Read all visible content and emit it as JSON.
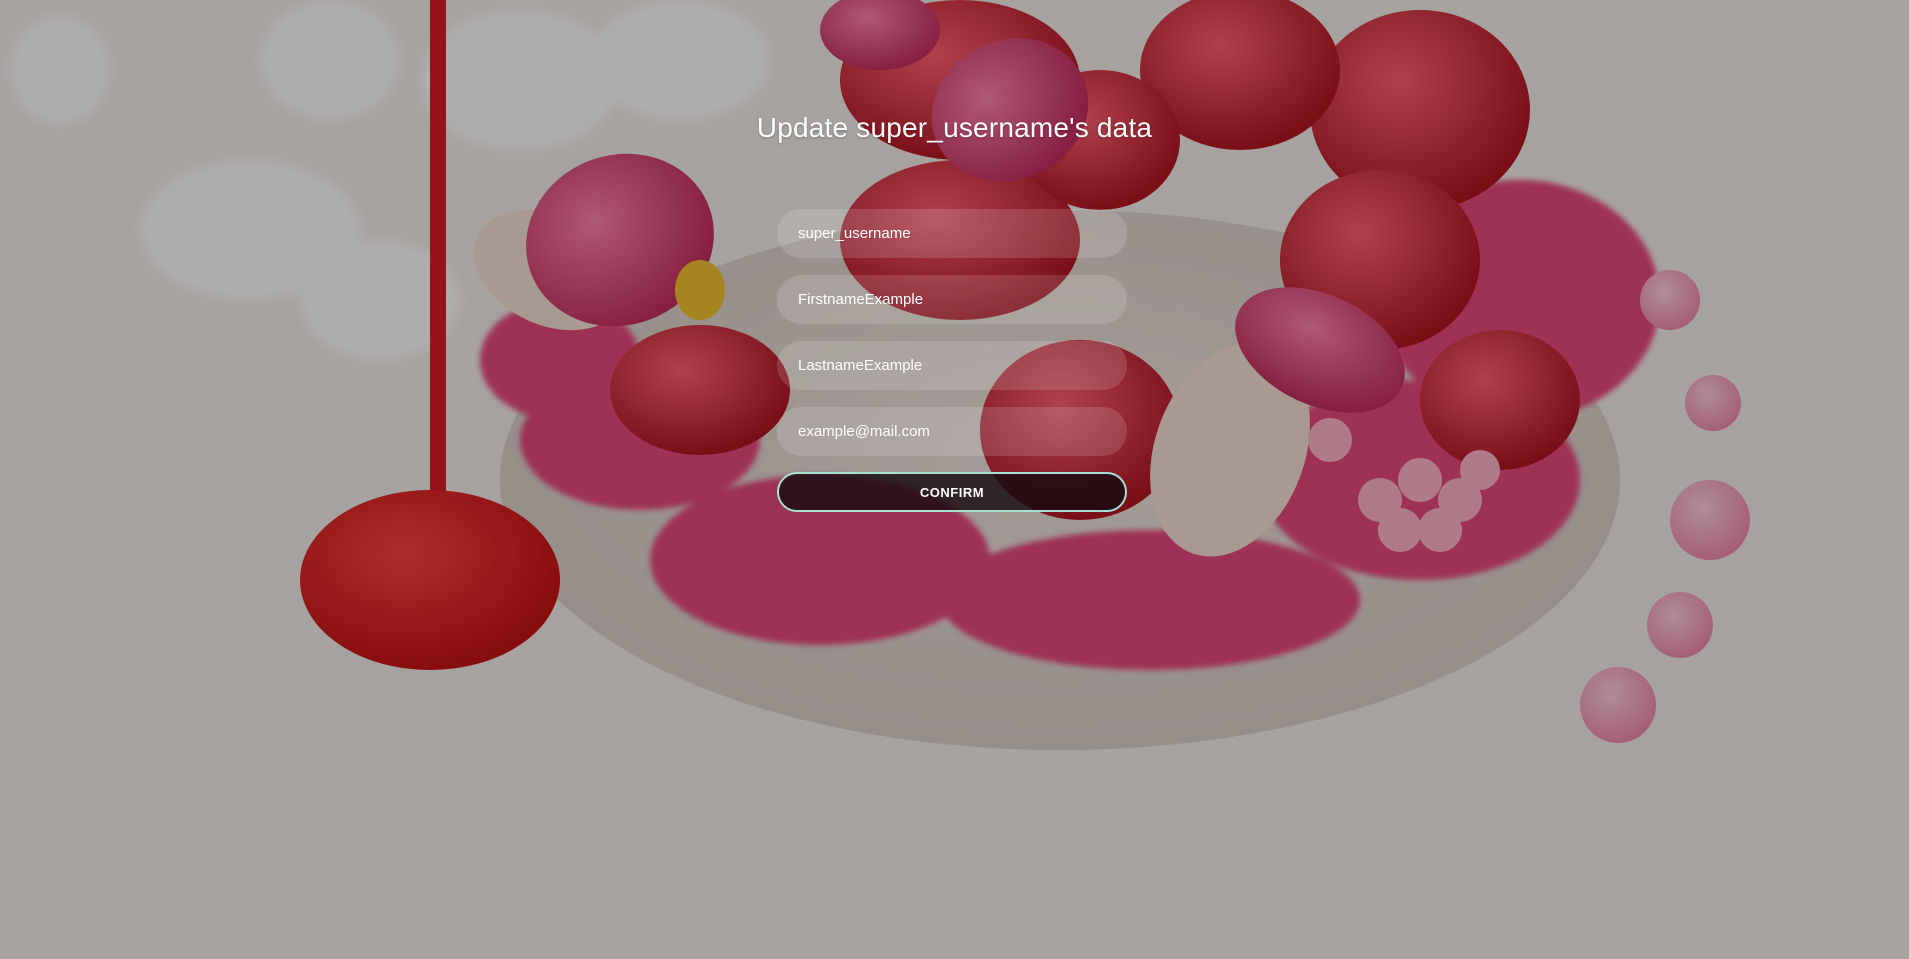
{
  "page": {
    "title": "Update super_username's data"
  },
  "form": {
    "username_value": "super_username",
    "firstname_value": "FirstnameExample",
    "lastname_value": "LastnameExample",
    "email_value": "example@mail.com",
    "confirm_label": "CONFIRM"
  },
  "colors": {
    "button_border": "#a6dfd4",
    "button_background": "#1c0d14",
    "field_background": "rgba(255,255,255,0.14)",
    "text": "#ffffff"
  }
}
